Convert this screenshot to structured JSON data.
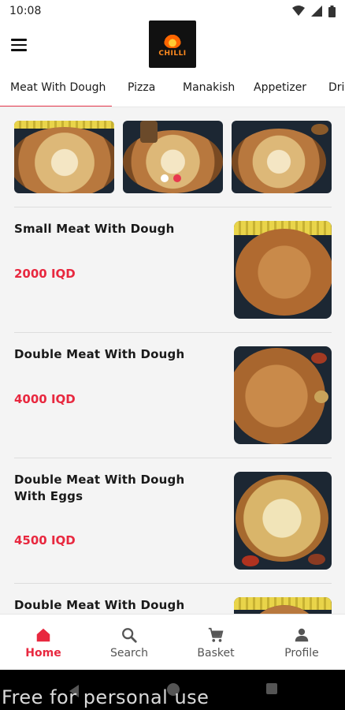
{
  "status_bar": {
    "time": "10:08"
  },
  "header": {
    "logo_text": "CHILLI"
  },
  "tabs": [
    {
      "label": "Meat With Dough"
    },
    {
      "label": "Pizza"
    },
    {
      "label": "Manakish"
    },
    {
      "label": "Appetizer"
    },
    {
      "label": "Dri"
    }
  ],
  "banner": {
    "slide_count": 3,
    "active_slide": 2
  },
  "items": [
    {
      "name": "Small Meat With Dough",
      "price": "2000 IQD"
    },
    {
      "name": "Double Meat With Dough",
      "price": "4000 IQD"
    },
    {
      "name": "Double Meat With Dough With Eggs",
      "price": "4500 IQD"
    },
    {
      "name": "Double Meat With Dough With",
      "price": ""
    }
  ],
  "bottom_nav": [
    {
      "label": "Home",
      "icon": "home-icon",
      "active": true
    },
    {
      "label": "Search",
      "icon": "search-icon",
      "active": false
    },
    {
      "label": "Basket",
      "icon": "cart-icon",
      "active": false
    },
    {
      "label": "Profile",
      "icon": "person-icon",
      "active": false
    }
  ],
  "watermark": "Free for personal use",
  "colors": {
    "accent": "#e8283f",
    "active_tab_line": "#e8384f"
  }
}
